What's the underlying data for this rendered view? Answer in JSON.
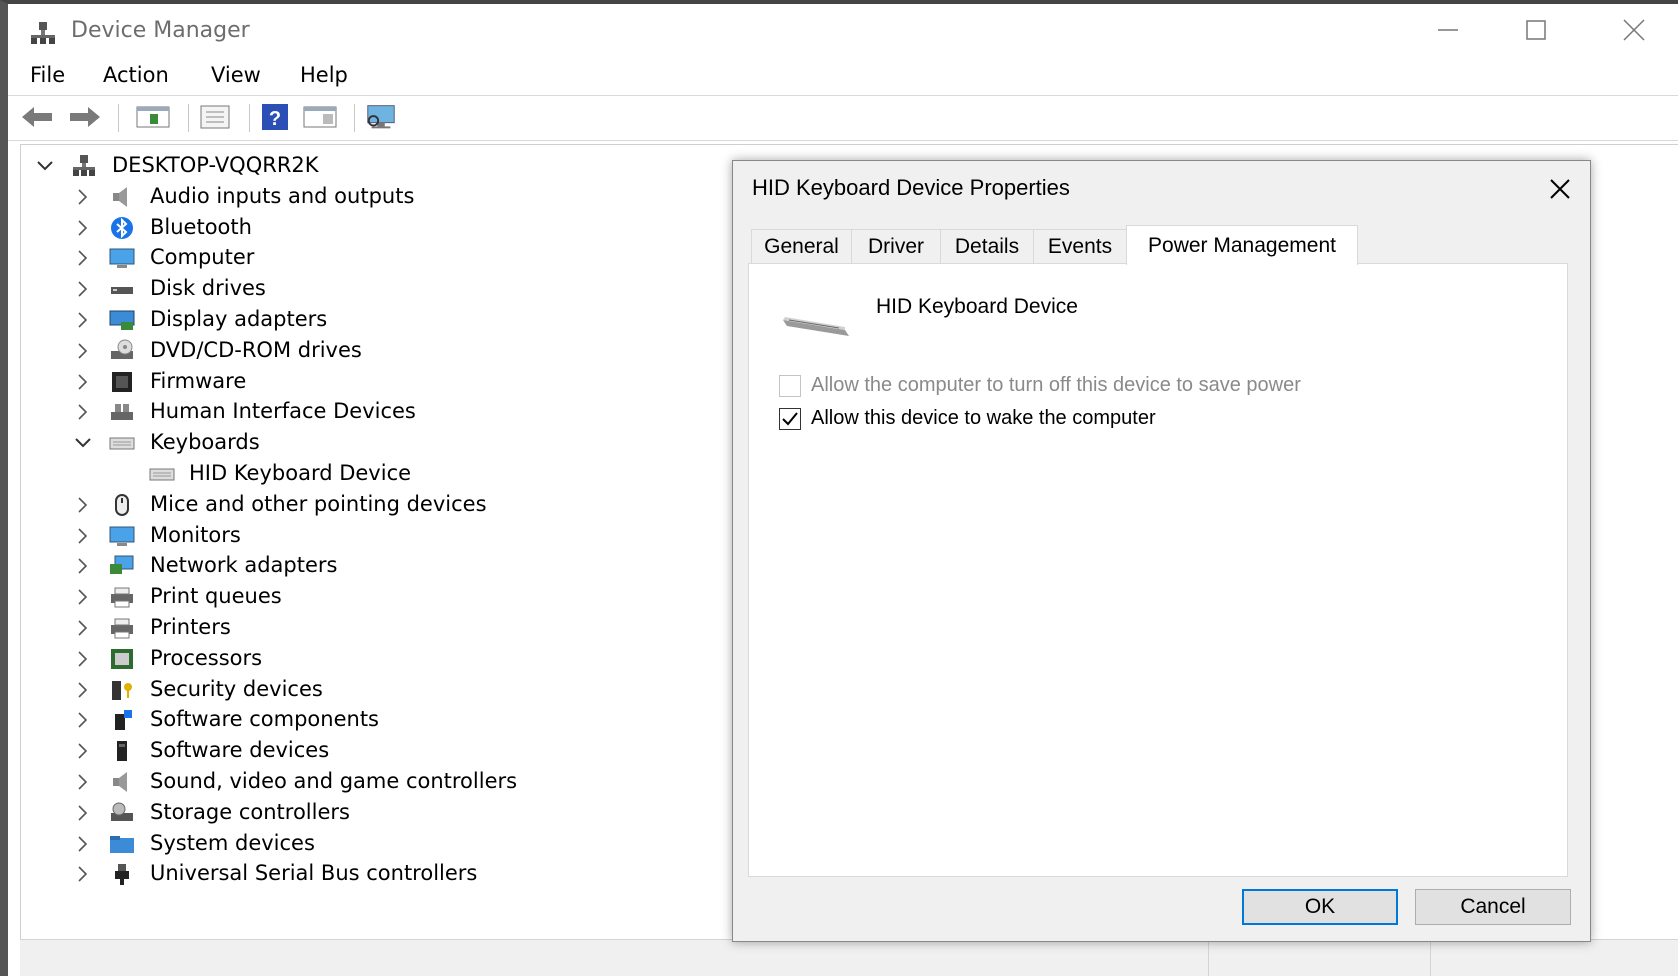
{
  "window": {
    "title": "Device Manager",
    "controls": {
      "minimize": "—",
      "maximize": "☐",
      "close": "✕"
    }
  },
  "menu": [
    "File",
    "Action",
    "View",
    "Help"
  ],
  "toolbar": {
    "icons": [
      "back-arrow-icon",
      "forward-arrow-icon",
      "show-hide-tree-icon",
      "properties-icon",
      "help-icon",
      "view-icon",
      "scan-hardware-icon"
    ]
  },
  "tree": {
    "root": "DESKTOP-VQQRR2K",
    "categories": [
      {
        "label": "Audio inputs and outputs",
        "icon": "speaker-icon",
        "expanded": false
      },
      {
        "label": "Bluetooth",
        "icon": "bluetooth-icon",
        "expanded": false
      },
      {
        "label": "Computer",
        "icon": "computer-icon",
        "expanded": false
      },
      {
        "label": "Disk drives",
        "icon": "disk-drive-icon",
        "expanded": false
      },
      {
        "label": "Display adapters",
        "icon": "display-adapter-icon",
        "expanded": false
      },
      {
        "label": "DVD/CD-ROM drives",
        "icon": "dvd-drive-icon",
        "expanded": false
      },
      {
        "label": "Firmware",
        "icon": "firmware-icon",
        "expanded": false
      },
      {
        "label": "Human Interface Devices",
        "icon": "hid-icon",
        "expanded": false
      },
      {
        "label": "Keyboards",
        "icon": "keyboard-icon",
        "expanded": true,
        "children": [
          "HID Keyboard Device"
        ]
      },
      {
        "label": "Mice and other pointing devices",
        "icon": "mouse-icon",
        "expanded": false
      },
      {
        "label": "Monitors",
        "icon": "monitor-icon",
        "expanded": false
      },
      {
        "label": "Network adapters",
        "icon": "network-adapter-icon",
        "expanded": false
      },
      {
        "label": "Print queues",
        "icon": "printer-icon",
        "expanded": false
      },
      {
        "label": "Printers",
        "icon": "printer-icon",
        "expanded": false
      },
      {
        "label": "Processors",
        "icon": "processor-icon",
        "expanded": false
      },
      {
        "label": "Security devices",
        "icon": "security-key-icon",
        "expanded": false
      },
      {
        "label": "Software components",
        "icon": "software-component-icon",
        "expanded": false
      },
      {
        "label": "Software devices",
        "icon": "software-device-icon",
        "expanded": false
      },
      {
        "label": "Sound, video and game controllers",
        "icon": "speaker-icon",
        "expanded": false
      },
      {
        "label": "Storage controllers",
        "icon": "storage-controller-icon",
        "expanded": false
      },
      {
        "label": "System devices",
        "icon": "system-folder-icon",
        "expanded": false
      },
      {
        "label": "Universal Serial Bus controllers",
        "icon": "usb-icon",
        "expanded": false
      }
    ]
  },
  "dialog": {
    "title": "HID Keyboard Device Properties",
    "tabs": [
      "General",
      "Driver",
      "Details",
      "Events",
      "Power Management"
    ],
    "active_tab": "Power Management",
    "device_name": "HID Keyboard Device",
    "options": [
      {
        "label": "Allow the computer to turn off this device to save power",
        "checked": false,
        "enabled": false
      },
      {
        "label": "Allow this device to wake the computer",
        "checked": true,
        "enabled": true
      }
    ],
    "ok_label": "OK",
    "cancel_label": "Cancel"
  }
}
